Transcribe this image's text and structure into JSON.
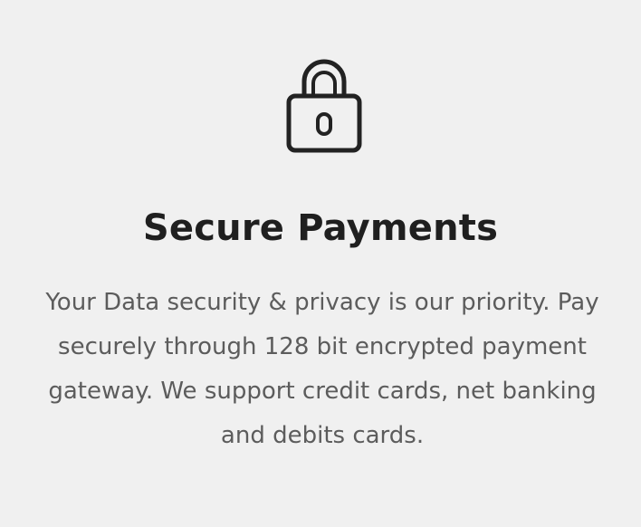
{
  "feature": {
    "icon": "lock-icon",
    "title": "Secure Payments",
    "description": "Your Data security & privacy is our priority. Pay securely through 128 bit encrypted payment gateway. We support credit cards, net banking and debits cards."
  },
  "colors": {
    "background": "#f0f0f0",
    "title": "#1f1f1f",
    "description": "#5c5c5c",
    "icon_stroke": "#222222"
  }
}
